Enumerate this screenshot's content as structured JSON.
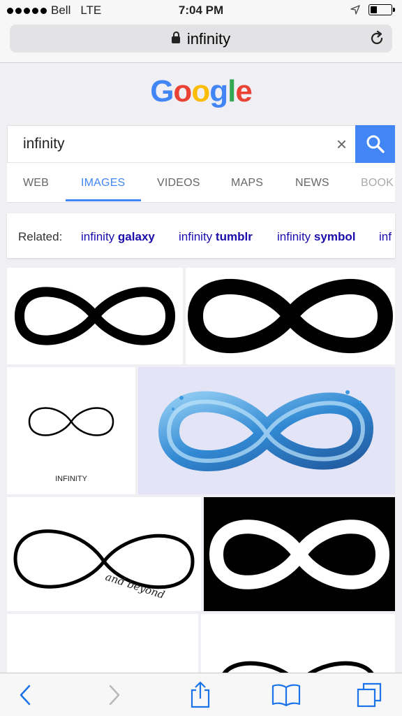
{
  "status": {
    "carrier": "Bell",
    "network": "LTE",
    "time": "7:04 PM",
    "battery_level": 0.35
  },
  "browser": {
    "url": "infinity",
    "toolbar_icons": [
      "back-icon",
      "forward-icon",
      "share-icon",
      "bookmarks-icon",
      "tabs-icon"
    ]
  },
  "google": {
    "logo_letters": [
      "G",
      "o",
      "o",
      "g",
      "l",
      "e"
    ],
    "logo_colors": [
      "#4285f4",
      "#ea4335",
      "#fbbc05",
      "#4285f4",
      "#34a853",
      "#ea4335"
    ]
  },
  "search": {
    "query": "infinity",
    "clear_icon": "×",
    "accent": "#4285f4"
  },
  "tabs": [
    {
      "label": "WEB",
      "active": false
    },
    {
      "label": "IMAGES",
      "active": true
    },
    {
      "label": "VIDEOS",
      "active": false
    },
    {
      "label": "MAPS",
      "active": false
    },
    {
      "label": "NEWS",
      "active": false
    },
    {
      "label": "BOOK",
      "active": false
    }
  ],
  "related": {
    "label": "Related:",
    "items": [
      {
        "prefix": "infinity ",
        "bold": "galaxy"
      },
      {
        "prefix": "infinity ",
        "bold": "tumblr"
      },
      {
        "prefix": "infinity ",
        "bold": "symbol"
      },
      {
        "prefix": "inf",
        "bold": ""
      }
    ],
    "link_color": "#1a0dab"
  },
  "results": {
    "caption_infinity": "INFINITY",
    "handwriting": "and beyond",
    "water_color": "#2e8fd6"
  }
}
